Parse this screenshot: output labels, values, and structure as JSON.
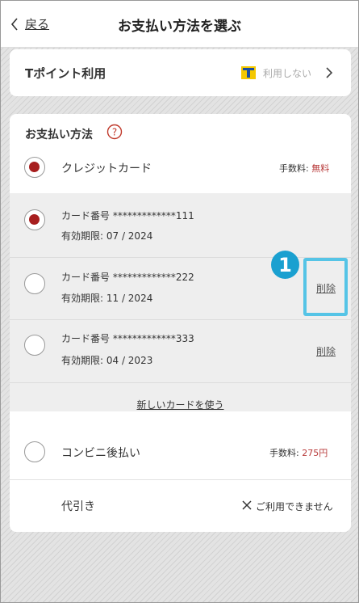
{
  "header": {
    "back_label": "戻る",
    "title": "お支払い方法を選ぶ"
  },
  "tpoint": {
    "label": "Tポイント利用",
    "value": "利用しない",
    "logo_letter": "T"
  },
  "payment": {
    "title": "お支払い方法",
    "credit": {
      "label": "クレジットカード",
      "fee_label": "手数料:",
      "fee_value": "無料"
    },
    "cards": [
      {
        "number": "カード番号 *************111",
        "expiry": "有効期限: 07 / 2024",
        "selected": true,
        "delete_label": ""
      },
      {
        "number": "カード番号 *************222",
        "expiry": "有効期限: 11 / 2024",
        "selected": false,
        "delete_label": "削除"
      },
      {
        "number": "カード番号 *************333",
        "expiry": "有効期限: 04 / 2023",
        "selected": false,
        "delete_label": "削除"
      }
    ],
    "new_card_label": "新しいカードを使う",
    "konbini": {
      "label": "コンビニ後払い",
      "fee_label": "手数料:",
      "fee_value": "275円"
    },
    "cod": {
      "label": "代引き",
      "status": "ご利用できません"
    }
  },
  "annotation": {
    "badge": "1"
  },
  "colors": {
    "accent_red": "#a71e1e",
    "callout_blue": "#55c4e6",
    "tpoint_yellow": "#f4c800",
    "tpoint_blue": "#1b4ea1"
  }
}
